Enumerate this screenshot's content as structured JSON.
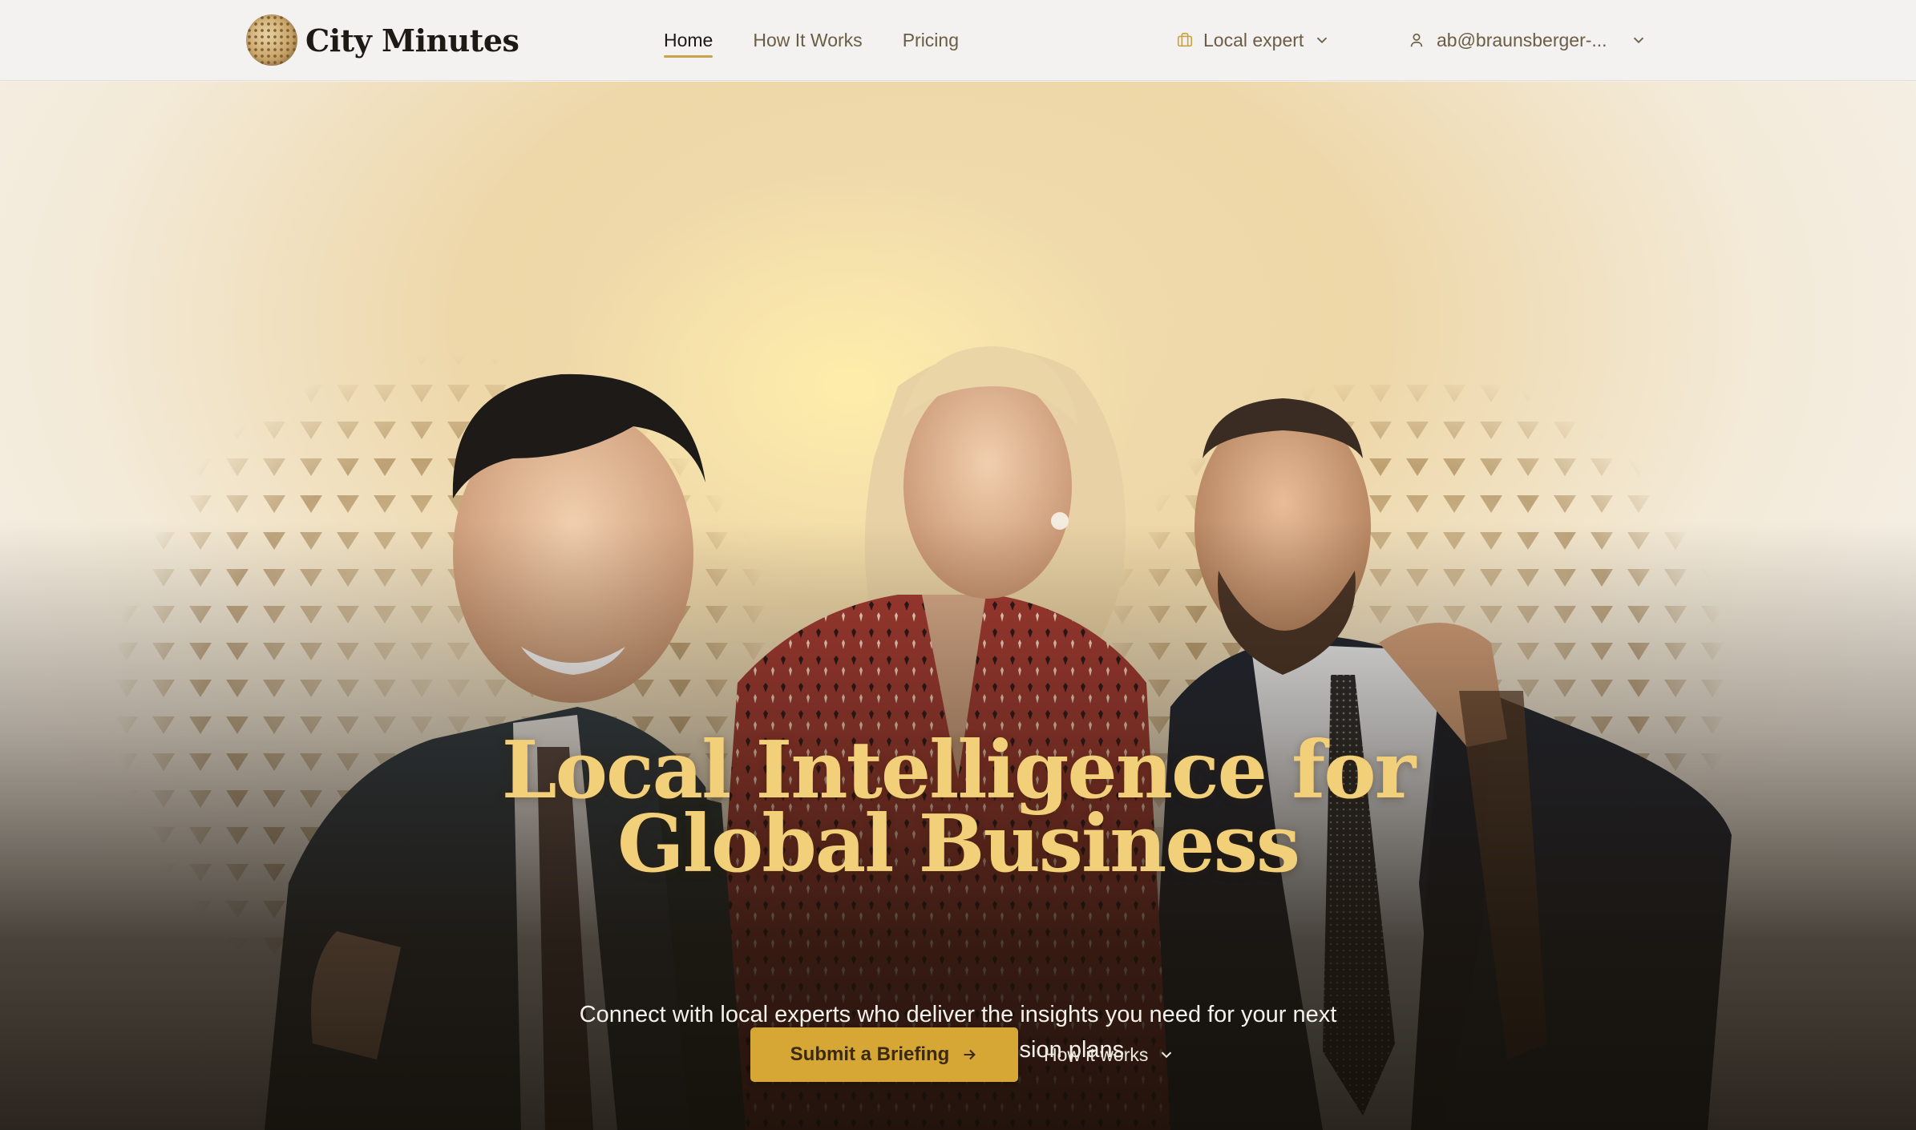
{
  "navbar": {
    "logo_text": "City Minutes",
    "links": [
      {
        "label": "Home",
        "active": true
      },
      {
        "label": "How It Works",
        "active": false
      },
      {
        "label": "Pricing",
        "active": false
      }
    ],
    "role_select": {
      "label": "Local expert",
      "icon": "briefcase-icon"
    },
    "user_select": {
      "label": "ab@braunsberger-...",
      "icon": "user-icon"
    }
  },
  "hero": {
    "title_line1": "Local Intelligence for",
    "title_line2": "Global Business",
    "subtitle_line1": "Connect with local experts who deliver the insights you need for your next",
    "subtitle_line2": "business trip or expansion plans",
    "primary_button": "Submit a Briefing",
    "secondary_button": "How it works"
  },
  "colors": {
    "accent": "#d6a734",
    "title_gold": "#f2cf79",
    "nav_background": "#f3f2f0"
  }
}
